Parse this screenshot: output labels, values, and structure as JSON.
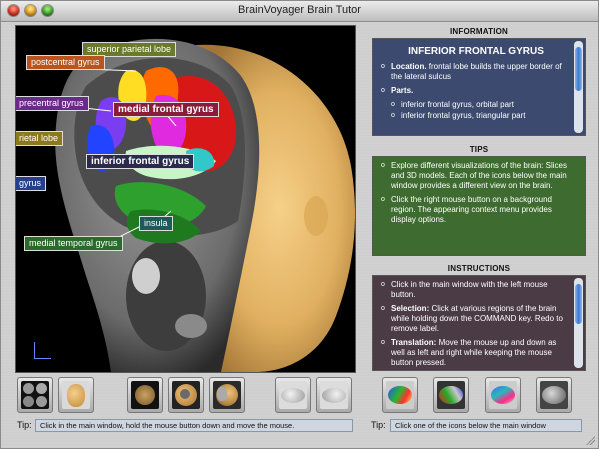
{
  "window": {
    "title": "BrainVoyager Brain Tutor"
  },
  "viewer": {
    "labels": {
      "parietal_lobe_sup": "superior parietal lobe",
      "postcentral": "postcentral gyrus",
      "precentral": "precentral gyrus",
      "medial_frontal": "medial frontal gyrus",
      "parietal_lobe": "rietal lobe",
      "inferior_frontal": "inferior frontal gyrus",
      "gyrus_left": "gyrus",
      "insula": "insula",
      "medial_temporal": "medial temporal gyrus"
    }
  },
  "information": {
    "header": "INFORMATION",
    "title": "INFERIOR FRONTAL GYRUS",
    "location_label": "Location.",
    "location_text": " frontal lobe builds the upper border of the lateral sulcus",
    "parts_label": "Parts.",
    "parts": [
      "inferior frontal gyrus, orbital part",
      "inferior frontal gyrus, triangular part"
    ]
  },
  "tips": {
    "header": "TIPS",
    "items": [
      "Explore different visualizations of the brain: Slices and 3D models. Each of the icons below the main window provides a different view on the brain.",
      "Click the right mouse button on a background region. The appearing context menu provides display options."
    ]
  },
  "instructions": {
    "header": "INSTRUCTIONS",
    "item1": "Click in the main window with the left mouse button.",
    "item2_label": "Selection:",
    "item2_text": " Click at various regions of the brain while holding down the COMMAND key. Redo to remove label.",
    "item3_label": "Translation:",
    "item3_text": " Move the mouse up and down as well as left and right while keeping the mouse button pressed."
  },
  "bottom": {
    "tip_label_left": "Tip:",
    "tip_text_left": "Click in the main window, hold the mouse button down and move the mouse.",
    "tip_label_right": "Tip:",
    "tip_text_right": "Click one of the icons below the main window"
  },
  "colors": {
    "info_bg": "#3b4a6e",
    "tips_bg": "#3e6b2f",
    "instr_bg": "#4a3b45"
  }
}
